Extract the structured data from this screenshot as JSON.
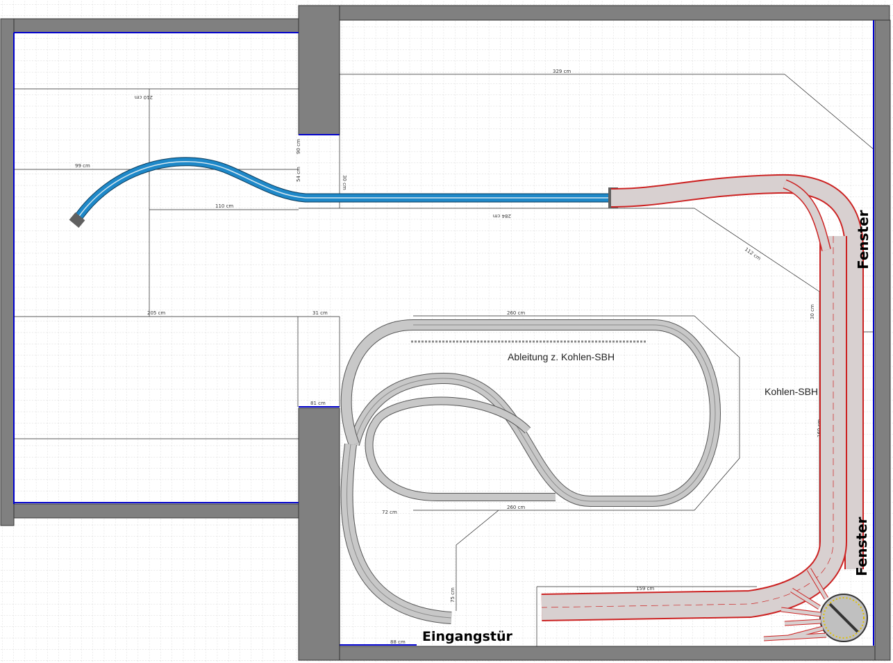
{
  "colors": {
    "background": "#ffffff",
    "grid": "#c8c8c8",
    "wall": "#808080",
    "wall_outline": "#333333",
    "room_edge": "#0000cc",
    "track_blue": "#1e88c8",
    "track_grey": "#c8c8c8",
    "track_red": "#cc2222",
    "track_red_fill": "#d8d0d0"
  },
  "labels": {
    "ableitung": "Ableitung z. Kohlen-SBH",
    "kohlen": "Kohlen-SBH",
    "fenster_top": "Fenster",
    "fenster_bottom": "Fenster",
    "eingang": "Eingangstür"
  },
  "dimensions": {
    "d_329": "329 cm",
    "d_99": "99 cm",
    "d_110": "110 cm",
    "d_205": "205 cm",
    "d_31": "31 cm",
    "d_260a": "260 cm",
    "d_260b": "260 cm",
    "d_81": "81 cm",
    "d_112": "112 cm",
    "d_30": "30 cm",
    "d_159": "159 cm",
    "d_75": "75 cm",
    "d_88": "88 cm",
    "d_72": "72 cm",
    "d_160a": "160 cm",
    "d_210": "210 cm",
    "d_90": "90 cm",
    "d_54": "54 cm",
    "d_30b": "30 cm",
    "d_284": "284 cm"
  }
}
